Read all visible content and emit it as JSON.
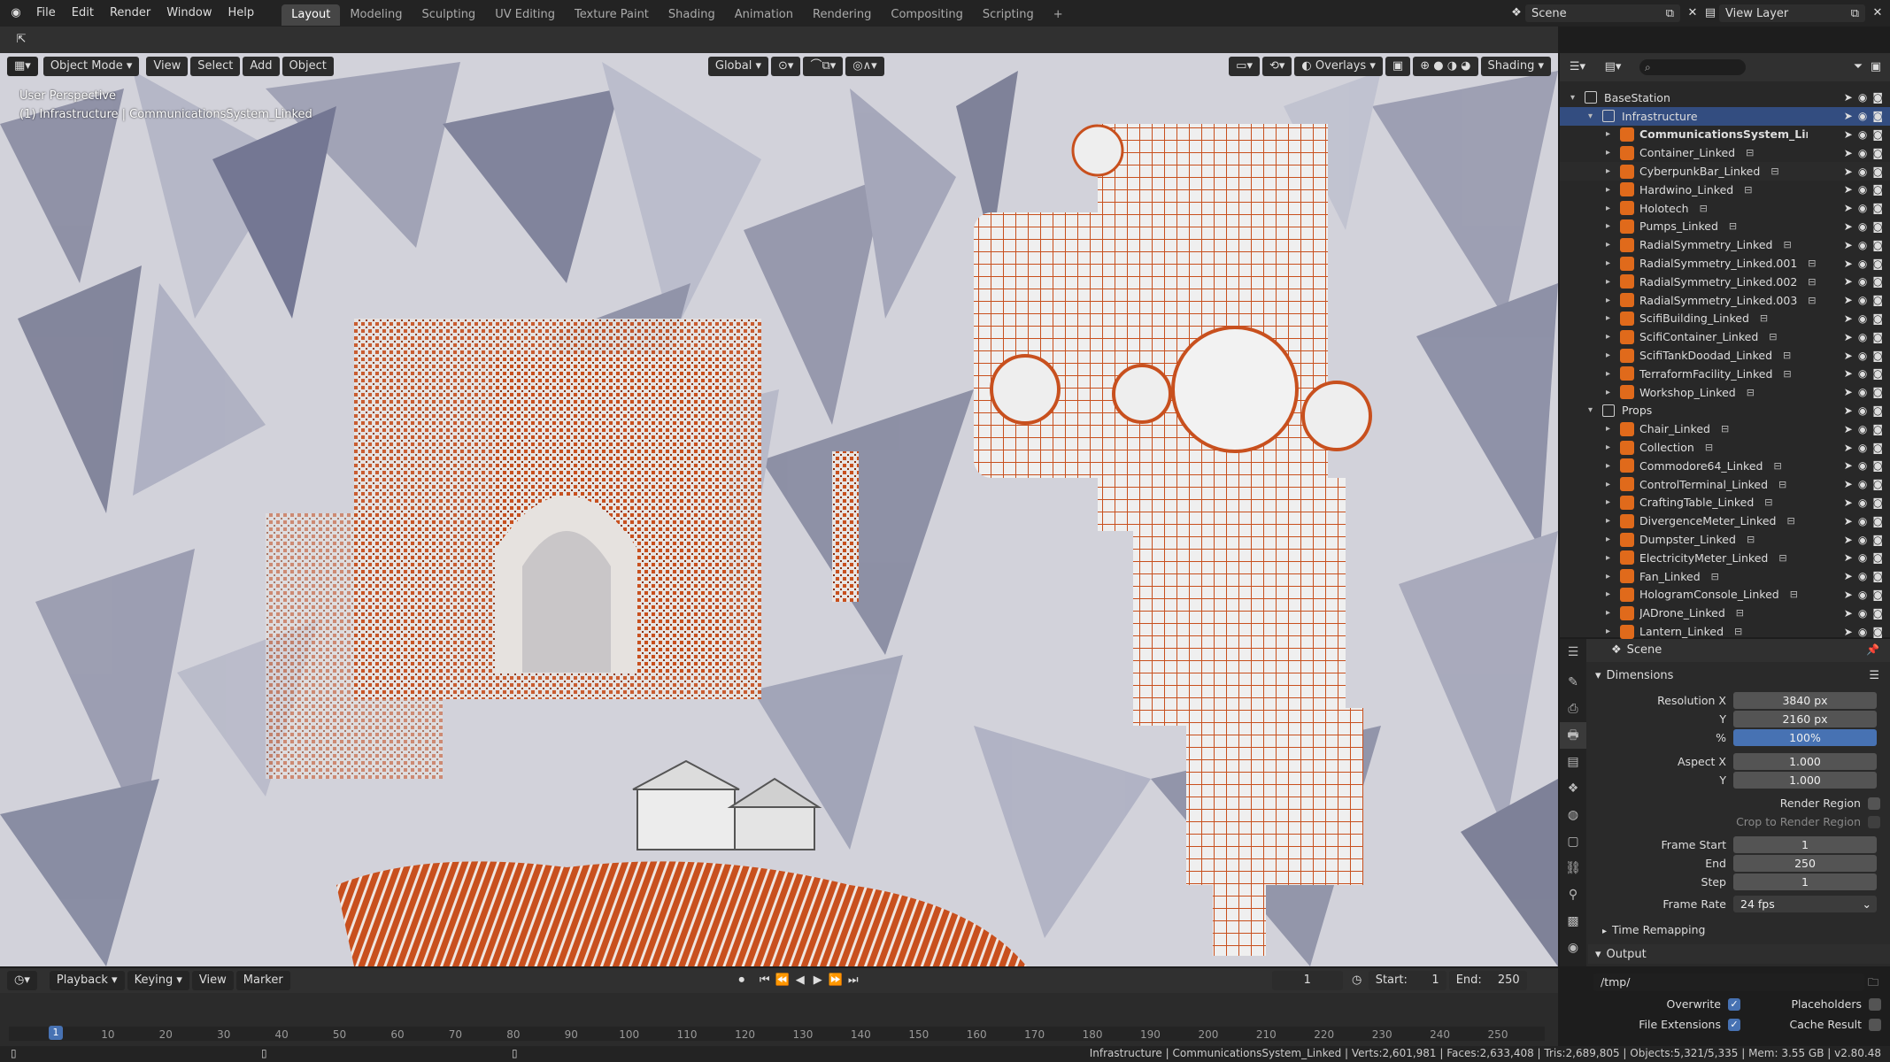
{
  "topbar": {
    "menus": [
      "File",
      "Edit",
      "Render",
      "Window",
      "Help"
    ],
    "workspaces": [
      "Layout",
      "Modeling",
      "Sculpting",
      "UV Editing",
      "Texture Paint",
      "Shading",
      "Animation",
      "Rendering",
      "Compositing",
      "Scripting"
    ],
    "active_workspace": "Layout",
    "add_tab": "+",
    "scene_name": "Scene",
    "view_layer": "View Layer"
  },
  "viewport": {
    "mode": "Object Mode",
    "menus": [
      "View",
      "Select",
      "Add",
      "Object"
    ],
    "orientation": "Global",
    "overlays": "Overlays",
    "shading": "Shading",
    "perspective_label": "User Perspective",
    "context_label": "(1) Infrastructure | CommunicationsSystem_Linked",
    "accent": "#c8501e"
  },
  "outliner": {
    "rows": [
      {
        "label": "BaseStation",
        "kind": "collection",
        "indent": 1,
        "expanded": true
      },
      {
        "label": "Infrastructure",
        "kind": "collection",
        "indent": 2,
        "expanded": true,
        "selected": true
      },
      {
        "label": "CommunicationsSystem_Linked",
        "kind": "object",
        "indent": 3,
        "bold": true
      },
      {
        "label": "Container_Linked",
        "kind": "object",
        "indent": 3
      },
      {
        "label": "CyberpunkBar_Linked",
        "kind": "object",
        "indent": 3,
        "alt": true
      },
      {
        "label": "Hardwino_Linked",
        "kind": "object",
        "indent": 3
      },
      {
        "label": "Holotech",
        "kind": "object",
        "indent": 3
      },
      {
        "label": "Pumps_Linked",
        "kind": "object",
        "indent": 3
      },
      {
        "label": "RadialSymmetry_Linked",
        "kind": "object",
        "indent": 3
      },
      {
        "label": "RadialSymmetry_Linked.001",
        "kind": "object",
        "indent": 3
      },
      {
        "label": "RadialSymmetry_Linked.002",
        "kind": "object",
        "indent": 3
      },
      {
        "label": "RadialSymmetry_Linked.003",
        "kind": "object",
        "indent": 3
      },
      {
        "label": "ScifiBuilding_Linked",
        "kind": "object",
        "indent": 3
      },
      {
        "label": "ScifiContainer_Linked",
        "kind": "object",
        "indent": 3
      },
      {
        "label": "ScifiTankDoodad_Linked",
        "kind": "object",
        "indent": 3
      },
      {
        "label": "TerraformFacility_Linked",
        "kind": "object",
        "indent": 3
      },
      {
        "label": "Workshop_Linked",
        "kind": "object",
        "indent": 3
      },
      {
        "label": "Props",
        "kind": "collection",
        "indent": 2,
        "expanded": true
      },
      {
        "label": "Chair_Linked",
        "kind": "object",
        "indent": 3
      },
      {
        "label": "Collection",
        "kind": "object",
        "indent": 3
      },
      {
        "label": "Commodore64_Linked",
        "kind": "object",
        "indent": 3
      },
      {
        "label": "ControlTerminal_Linked",
        "kind": "object",
        "indent": 3
      },
      {
        "label": "CraftingTable_Linked",
        "kind": "object",
        "indent": 3
      },
      {
        "label": "DivergenceMeter_Linked",
        "kind": "object",
        "indent": 3
      },
      {
        "label": "Dumpster_Linked",
        "kind": "object",
        "indent": 3
      },
      {
        "label": "ElectricityMeter_Linked",
        "kind": "object",
        "indent": 3
      },
      {
        "label": "Fan_Linked",
        "kind": "object",
        "indent": 3
      },
      {
        "label": "HologramConsole_Linked",
        "kind": "object",
        "indent": 3
      },
      {
        "label": "JADrone_Linked",
        "kind": "object",
        "indent": 3
      },
      {
        "label": "Lantern_Linked",
        "kind": "object",
        "indent": 3
      }
    ]
  },
  "properties": {
    "context": "Scene",
    "dimensions_title": "Dimensions",
    "resolution_x_label": "Resolution X",
    "resolution_x": "3840 px",
    "y_label": "Y",
    "resolution_y": "2160 px",
    "percent_label": "%",
    "percent": "100%",
    "aspect_x_label": "Aspect X",
    "aspect_x": "1.000",
    "aspect_y": "1.000",
    "render_region": "Render Region",
    "crop_region": "Crop to Render Region",
    "frame_start_label": "Frame Start",
    "frame_start": "1",
    "end_label": "End",
    "frame_end": "250",
    "step_label": "Step",
    "step": "1",
    "frame_rate_label": "Frame Rate",
    "frame_rate": "24 fps",
    "time_remapping": "Time Remapping",
    "output_title": "Output",
    "output_path": "/tmp/",
    "overwrite": "Overwrite",
    "placeholders": "Placeholders",
    "file_extensions": "File Extensions",
    "cache_result": "Cache Result"
  },
  "timeline": {
    "menus": [
      "Playback",
      "Keying",
      "View",
      "Marker"
    ],
    "current_frame": "1",
    "start_label": "Start:",
    "start": "1",
    "end_label": "End:",
    "end": "250",
    "ticks": [
      "1",
      "10",
      "20",
      "30",
      "40",
      "50",
      "60",
      "70",
      "80",
      "90",
      "100",
      "110",
      "120",
      "130",
      "140",
      "150",
      "160",
      "170",
      "180",
      "190",
      "200",
      "210",
      "220",
      "230",
      "240",
      "250"
    ]
  },
  "status": {
    "text": "Infrastructure | CommunicationsSystem_Linked | Verts:2,601,981 | Faces:2,633,408 | Tris:2,689,805 | Objects:5,321/5,335 | Mem: 3.55 GB | v2.80.48"
  }
}
